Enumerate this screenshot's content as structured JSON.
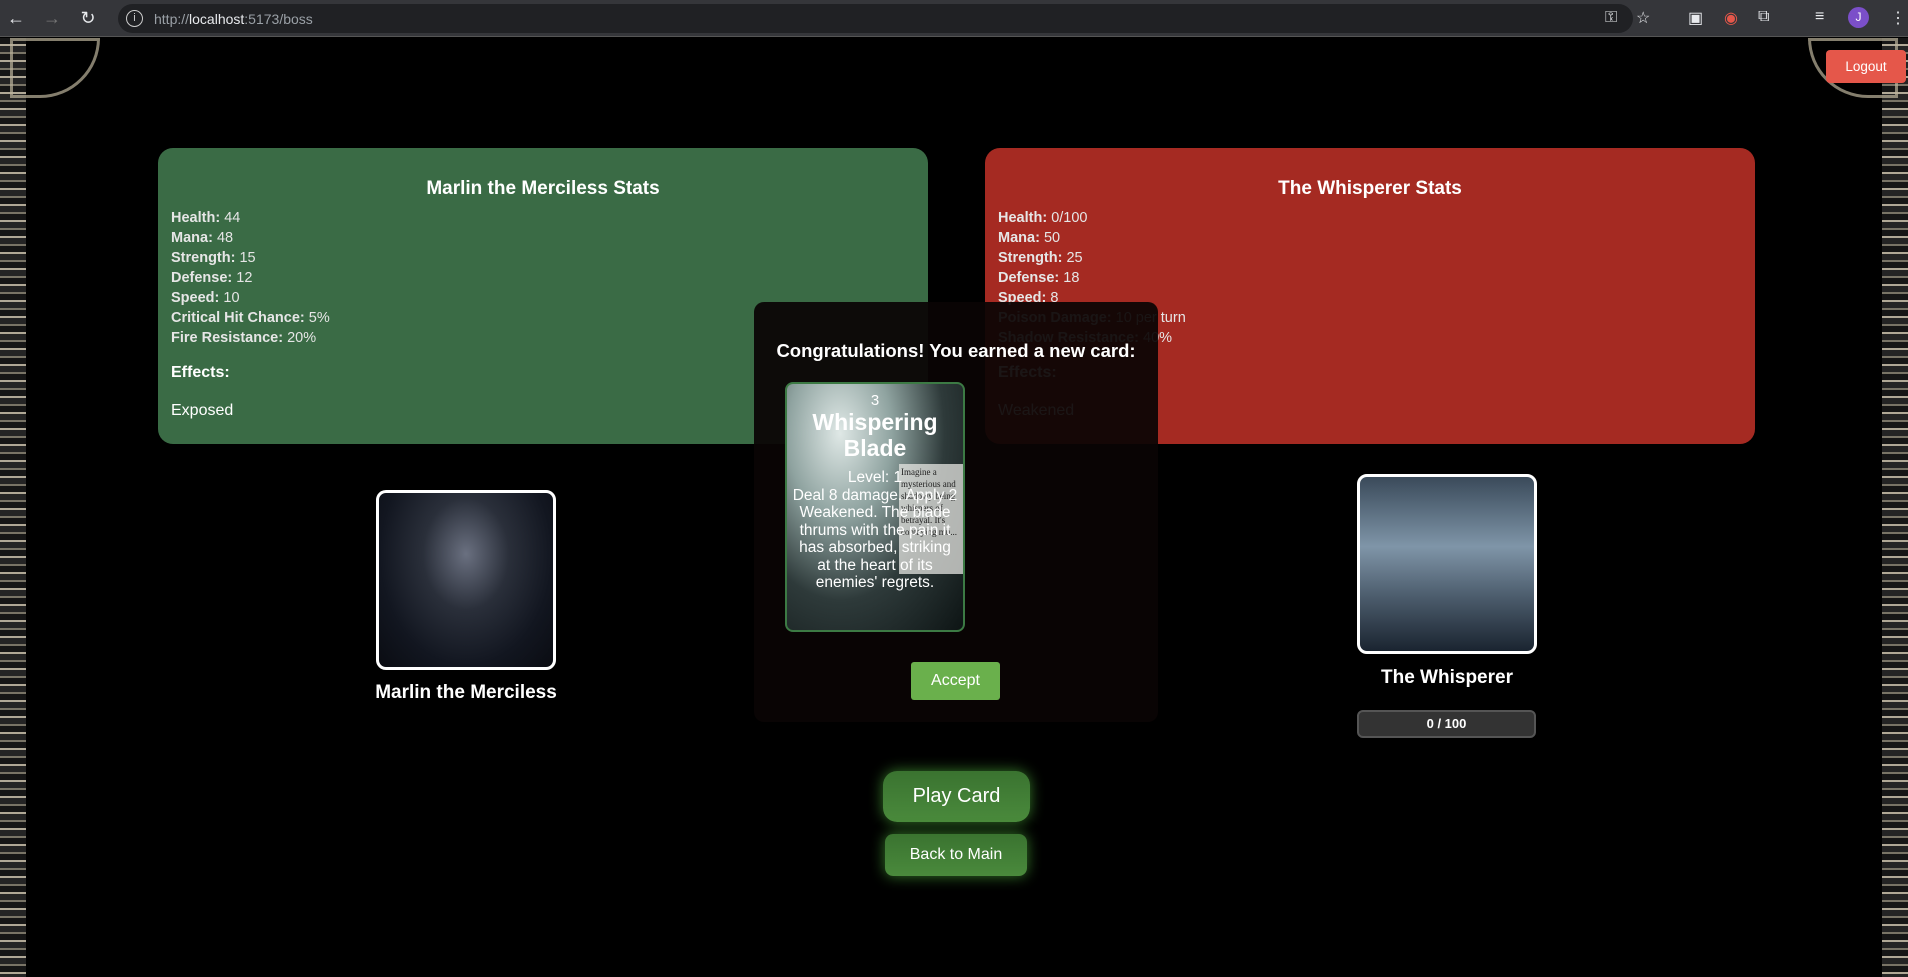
{
  "browser": {
    "url_prefix": "http://",
    "url_host": "localhost",
    "url_rest": ":5173/boss",
    "avatar_letter": "J"
  },
  "logout_label": "Logout",
  "player": {
    "stats_title": "Marlin the Merciless Stats",
    "name": "Marlin the Merciless",
    "stats": [
      {
        "label": "Health:",
        "value": "44"
      },
      {
        "label": "Mana:",
        "value": "48"
      },
      {
        "label": "Strength:",
        "value": "15"
      },
      {
        "label": "Defense:",
        "value": "12"
      },
      {
        "label": "Speed:",
        "value": "10"
      },
      {
        "label": "Critical Hit Chance:",
        "value": "5%"
      },
      {
        "label": "Fire Resistance:",
        "value": "20%"
      }
    ],
    "effects_label": "Effects:",
    "effects": [
      "Exposed"
    ],
    "color": "#3a6b45"
  },
  "boss": {
    "stats_title": "The Whisperer Stats",
    "name": "The Whisperer",
    "hp_text": "0 / 100",
    "hp_fraction": 0,
    "stats": [
      {
        "label": "Health:",
        "value": "0/100"
      },
      {
        "label": "Mana:",
        "value": "50"
      },
      {
        "label": "Strength:",
        "value": "25"
      },
      {
        "label": "Defense:",
        "value": "18"
      },
      {
        "label": "Speed:",
        "value": "8"
      },
      {
        "label": "Poison Damage:",
        "value": "10 per turn"
      },
      {
        "label": "Shadow Resistance:",
        "value": "40%"
      }
    ],
    "effects_label": "Effects:",
    "effects": [
      "Weakened"
    ],
    "color": "#a52a22"
  },
  "modal": {
    "heading": "Congratulations! You earned a new card:",
    "accept_label": "Accept",
    "card": {
      "cost": "3",
      "name": "Whispering Blade",
      "level": "Level: 1",
      "description": "Deal 8 damage. Apply 2 Weakened. The blade thrums with the pain it has absorbed, striking at the heart of its enemies' regrets.",
      "lore": "Imagine a mysterious and shadowy being whispers of betrayal. It's contaying mu..."
    }
  },
  "actions": {
    "play_card": "Play Card",
    "back_to_main": "Back to Main"
  }
}
